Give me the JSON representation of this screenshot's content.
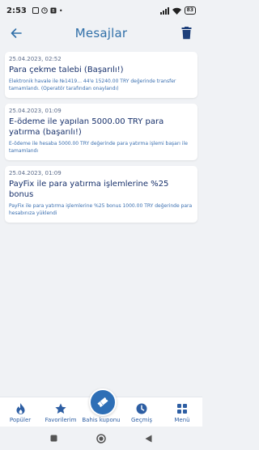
{
  "status_bar": {
    "time": "2:53",
    "battery": "83"
  },
  "header": {
    "title": "Mesajlar"
  },
  "messages": [
    {
      "date": "25.04.2023, 02:52",
      "title": "Para çekme talebi (Başarılı!)",
      "body": "Elektronik havale ile №1419... 44'e 15240.00 TRY değerinde transfer tamamlandı. (Operatör tarafından onaylandı)"
    },
    {
      "date": "25.04.2023, 01:09",
      "title": "E-ödeme ile yapılan 5000.00 TRY para yatırma (başarılı!)",
      "body": "E-ödeme ile hesaba 5000.00 TRY değerinde para yatırma işlemi başarı ile tamamlandı"
    },
    {
      "date": "25.04.2023, 01:09",
      "title": "PayFix ile para yatırma işlemlerine %25 bonus",
      "body": "PayFix ile para yatırma işlemlerine %25 bonus 1000.00 TRY değerinde para hesabınıza yüklendi"
    }
  ],
  "bottom_nav": {
    "items": [
      {
        "label": "Popüler",
        "icon": "flame-icon"
      },
      {
        "label": "Favorilerim",
        "icon": "star-icon"
      },
      {
        "label": "Bahis kuponu",
        "icon": "ticket-icon"
      },
      {
        "label": "Geçmiş",
        "icon": "clock-icon"
      },
      {
        "label": "Menü",
        "icon": "grid-icon"
      }
    ]
  },
  "colors": {
    "accent": "#2e6fb6",
    "title_text": "#17306b",
    "body_text": "#3a6fb0",
    "background": "#f0f2f5"
  }
}
